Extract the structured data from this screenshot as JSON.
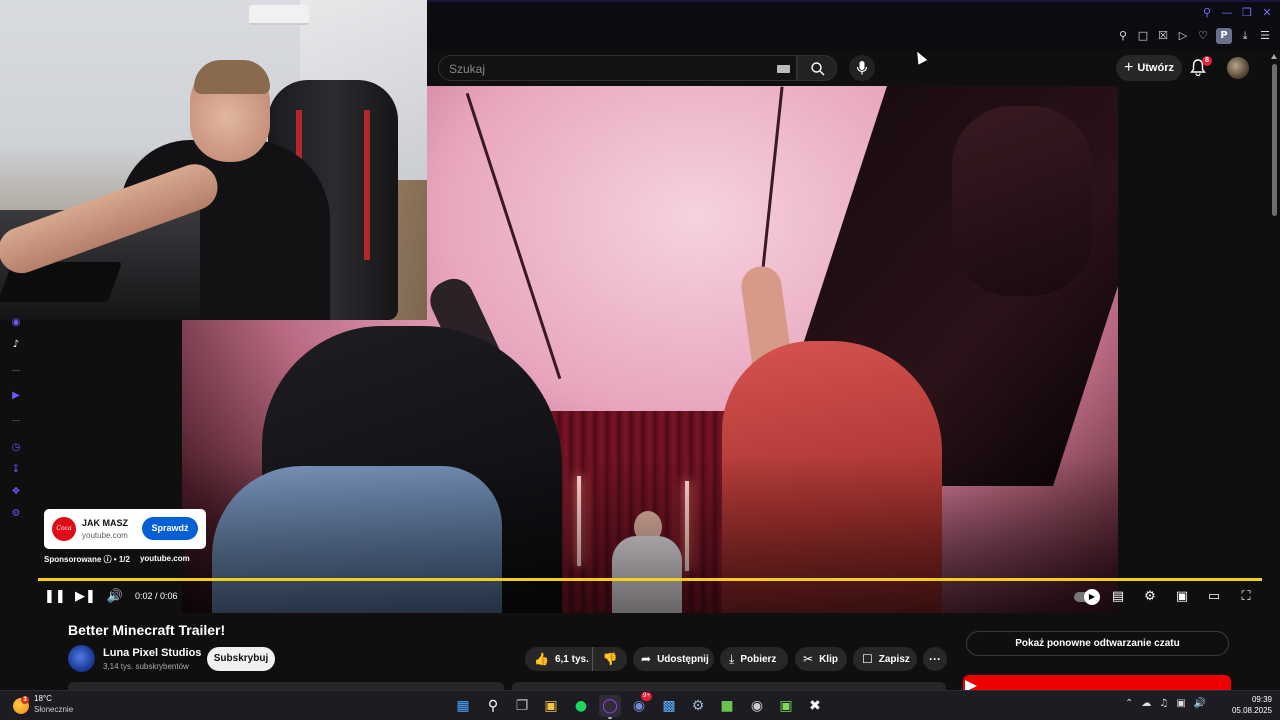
{
  "browser": {
    "window_controls": [
      "search-icon",
      "minimize-icon",
      "restore-icon",
      "close-icon"
    ],
    "extensions": [
      "pin-icon",
      "screenshot-icon",
      "shield-icon",
      "play-icon",
      "heart-icon"
    ],
    "profile_initial": "P"
  },
  "header": {
    "search_placeholder": "Szukaj",
    "create_label": "Utwórz",
    "notifications_count": "8"
  },
  "player": {
    "time_display": "0:02 / 0:06",
    "progress_played_fraction": 0.0,
    "progress_loaded_fraction": 0.35,
    "accent_color": "#f5cd1b",
    "icons": [
      "pause-icon",
      "next-icon",
      "volume-icon",
      "autoplay-toggle",
      "subtitles-icon",
      "settings-icon",
      "miniplayer-icon",
      "theater-icon",
      "fullscreen-icon"
    ]
  },
  "ad": {
    "title": "JAK MASZ",
    "domain": "youtube.com",
    "cta_label": "Sprawdź",
    "sponsored_label": "Sponsorowane",
    "ad_count": "1/2",
    "ad_domain": "youtube.com",
    "brand_color": "#e10a17"
  },
  "video": {
    "title": "Better Minecraft Trailer!",
    "channel_name": "Luna Pixel Studios",
    "subscribers": "3,14 tys. subskrybentów",
    "subscribe_label": "Subskrybuj",
    "likes": "6,1 tys.",
    "share_label": "Udostępnij",
    "download_label": "Pobierz",
    "clip_label": "Klip",
    "save_label": "Zapisz",
    "more_label": "···"
  },
  "chat": {
    "replay_label": "Pokaż ponowne odtwarzanie czatu"
  },
  "left_guide": {
    "icons": [
      "instagram-icon",
      "tiktok-icon",
      "play-circle-icon",
      "history-icon",
      "download-icon",
      "puzzle-icon",
      "settings-icon"
    ],
    "bottom_label": "GX"
  },
  "taskbar": {
    "temperature": "18°C",
    "weather": "Słonecznie",
    "weather_badge": "3",
    "time": "09:39",
    "date": "05.08.2025",
    "discord_badge": "9+",
    "apps": [
      "windows-start-icon",
      "search-icon",
      "task-view-icon",
      "file-explorer-icon",
      "spotify-icon",
      "opera-gx-icon",
      "discord-icon",
      "store-icon",
      "steam-icon",
      "minecraft-icon",
      "chrome-icon",
      "app-icon",
      "capcut-icon"
    ]
  }
}
